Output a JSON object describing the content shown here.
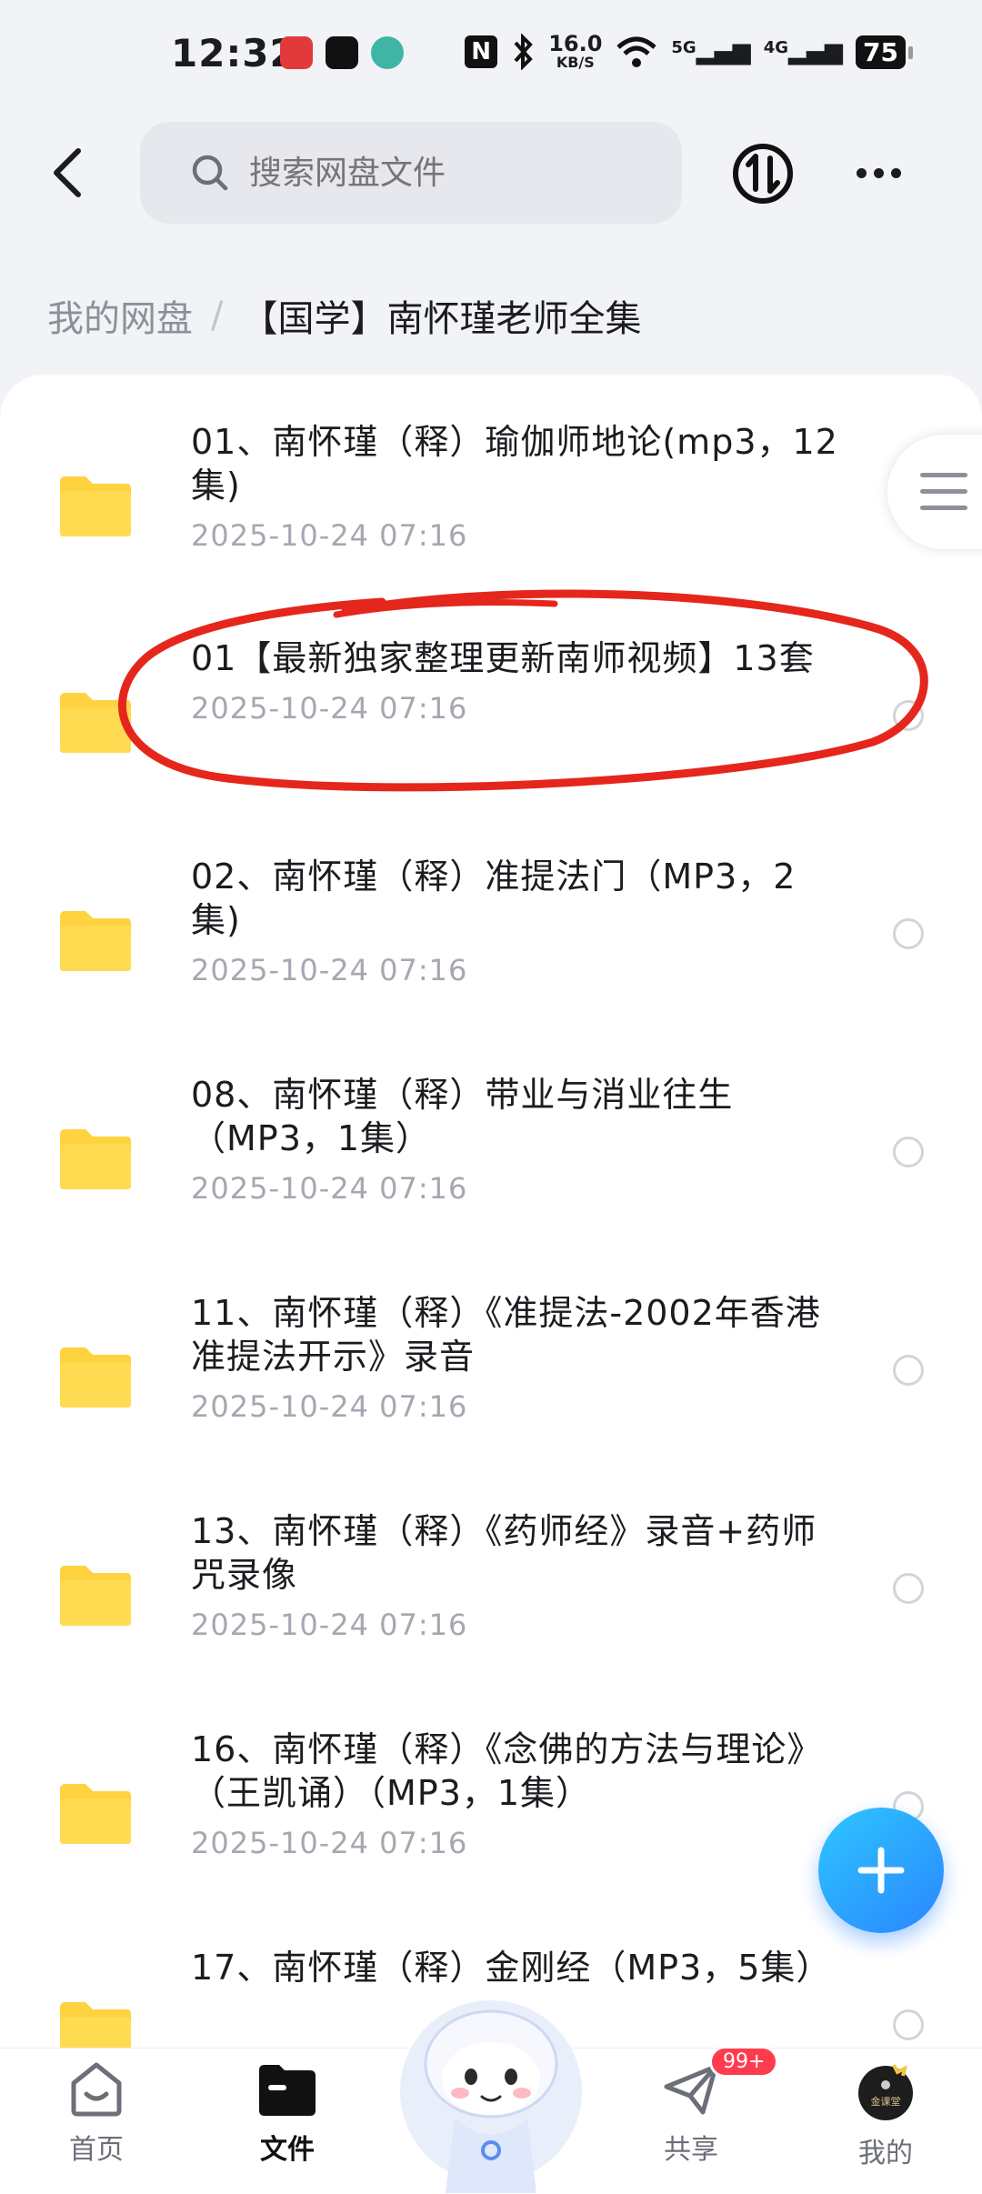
{
  "status_bar": {
    "time": "12:32",
    "nfc": "N",
    "net_speed_value": "16.0",
    "net_speed_unit": "KB/S",
    "signal_1": "5G",
    "signal_2": "4G",
    "battery": "75"
  },
  "header": {
    "search_placeholder": "搜索网盘文件"
  },
  "breadcrumb": {
    "root": "我的网盘",
    "separator": "/",
    "current": "【国学】南怀瑾老师全集"
  },
  "files": [
    {
      "name": "01、南怀瑾（释）瑜伽师地论(mp3，12集)",
      "date": "2025-10-24  07:16"
    },
    {
      "name": "01【最新独家整理更新南师视频】13套",
      "date": "2025-10-24  07:16"
    },
    {
      "name": "02、南怀瑾（释）准提法门（MP3，2集)",
      "date": "2025-10-24  07:16"
    },
    {
      "name": "08、南怀瑾（释）带业与消业往生（MP3，1集）",
      "date": "2025-10-24  07:16"
    },
    {
      "name": "11、南怀瑾（释）《准提法-2002年香港准提法开示》录音",
      "date": "2025-10-24  07:16"
    },
    {
      "name": "13、南怀瑾（释）《药师经》录音+药师咒录像",
      "date": "2025-10-24  07:16"
    },
    {
      "name": "16、南怀瑾（释）《念佛的方法与理论》（王凯诵）（MP3，1集）",
      "date": "2025-10-24  07:16"
    },
    {
      "name": "17、南怀瑾（释）金刚经（MP3，5集）",
      "date": ""
    }
  ],
  "tabbar": {
    "home": "首页",
    "files": "文件",
    "share": "共享",
    "share_badge": "99+",
    "mine": "我的",
    "avatar_text": "金课堂"
  },
  "colors": {
    "accent": "#2a86ff",
    "folder": "#ffd23f",
    "annotation": "#e5261c",
    "badge": "#ff3b4e"
  }
}
